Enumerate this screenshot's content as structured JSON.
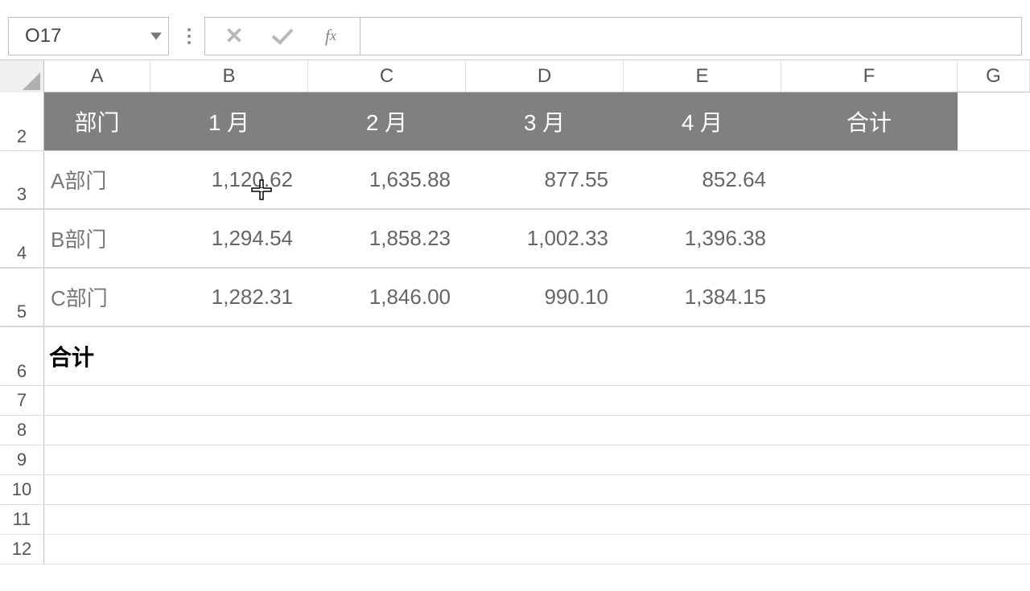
{
  "name_box": "O17",
  "formula_input": "",
  "columns": [
    "A",
    "B",
    "C",
    "D",
    "E",
    "F",
    "G"
  ],
  "row_numbers": [
    2,
    3,
    4,
    5,
    6,
    7,
    8,
    9,
    10,
    11,
    12
  ],
  "header": {
    "dept": "部门",
    "m1": "1 月",
    "m2": "2 月",
    "m3": "3 月",
    "m4": "4 月",
    "total": "合计"
  },
  "data": [
    {
      "name": "A部门",
      "m1": "1,120.62",
      "m2": "1,635.88",
      "m3": "877.55",
      "m4": "852.64",
      "total": ""
    },
    {
      "name": "B部门",
      "m1": "1,294.54",
      "m2": "1,858.23",
      "m3": "1,002.33",
      "m4": "1,396.38",
      "total": ""
    },
    {
      "name": "C部门",
      "m1": "1,282.31",
      "m2": "1,846.00",
      "m3": "990.10",
      "m4": "1,384.15",
      "total": ""
    }
  ],
  "total_label": "合计",
  "chart_data": {
    "type": "table",
    "columns": [
      "部门",
      "1 月",
      "2 月",
      "3 月",
      "4 月",
      "合计"
    ],
    "rows": [
      [
        "A部门",
        1120.62,
        1635.88,
        877.55,
        852.64,
        null
      ],
      [
        "B部门",
        1294.54,
        1858.23,
        1002.33,
        1396.38,
        null
      ],
      [
        "C部门",
        1282.31,
        1846.0,
        990.1,
        1384.15,
        null
      ],
      [
        "合计",
        null,
        null,
        null,
        null,
        null
      ]
    ]
  }
}
